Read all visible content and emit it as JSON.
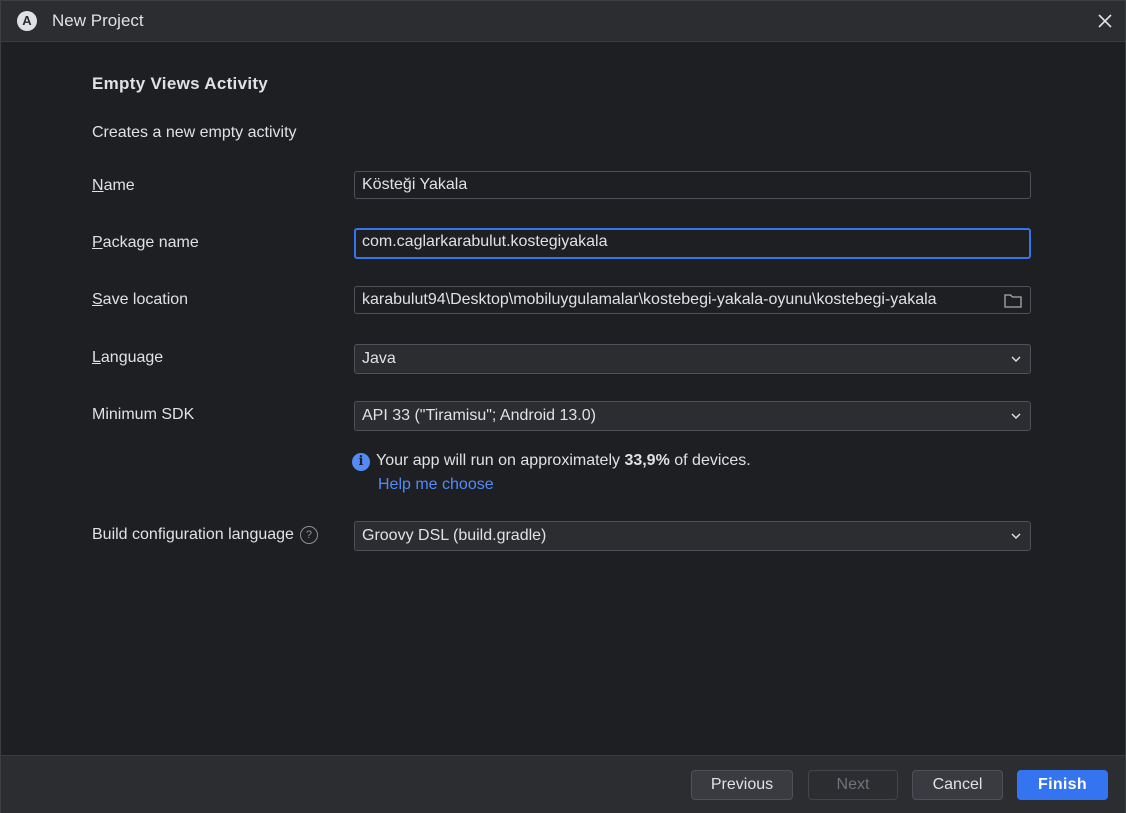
{
  "window": {
    "title": "New Project",
    "app_icon_glyph": "A"
  },
  "page": {
    "heading": "Empty Views Activity",
    "description": "Creates a new empty activity"
  },
  "form": {
    "name": {
      "label_mnemonic": "N",
      "label_rest": "ame",
      "value": "Kösteği Yakala"
    },
    "package_name": {
      "label_mnemonic": "P",
      "label_rest": "ackage name",
      "value": "com.caglarkarabulut.kostegiyakala"
    },
    "save_location": {
      "label_mnemonic": "S",
      "label_rest": "ave location",
      "value": "karabulut94\\Desktop\\mobiluygulamalar\\kostebegi-yakala-oyunu\\kostebegi-yakala",
      "icon": "folder-icon"
    },
    "language": {
      "label_mnemonic": "L",
      "label_rest": "anguage",
      "value": "Java"
    },
    "minimum_sdk": {
      "label": "Minimum SDK",
      "value": "API 33 (\"Tiramisu\"; Android 13.0)"
    },
    "build_config": {
      "label": "Build configuration language",
      "help_icon": "?",
      "value": "Groovy DSL (build.gradle)"
    }
  },
  "info": {
    "icon": "i",
    "text_before": "Your app will run on approximately ",
    "percent": "33,9%",
    "text_after": " of devices.",
    "help_link": "Help me choose"
  },
  "footer": {
    "previous": "Previous",
    "next": "Next",
    "cancel": "Cancel",
    "finish": "Finish"
  },
  "colors": {
    "accent": "#3574f0",
    "link": "#548af7",
    "background": "#1e1f22",
    "panel": "#2b2d30"
  }
}
